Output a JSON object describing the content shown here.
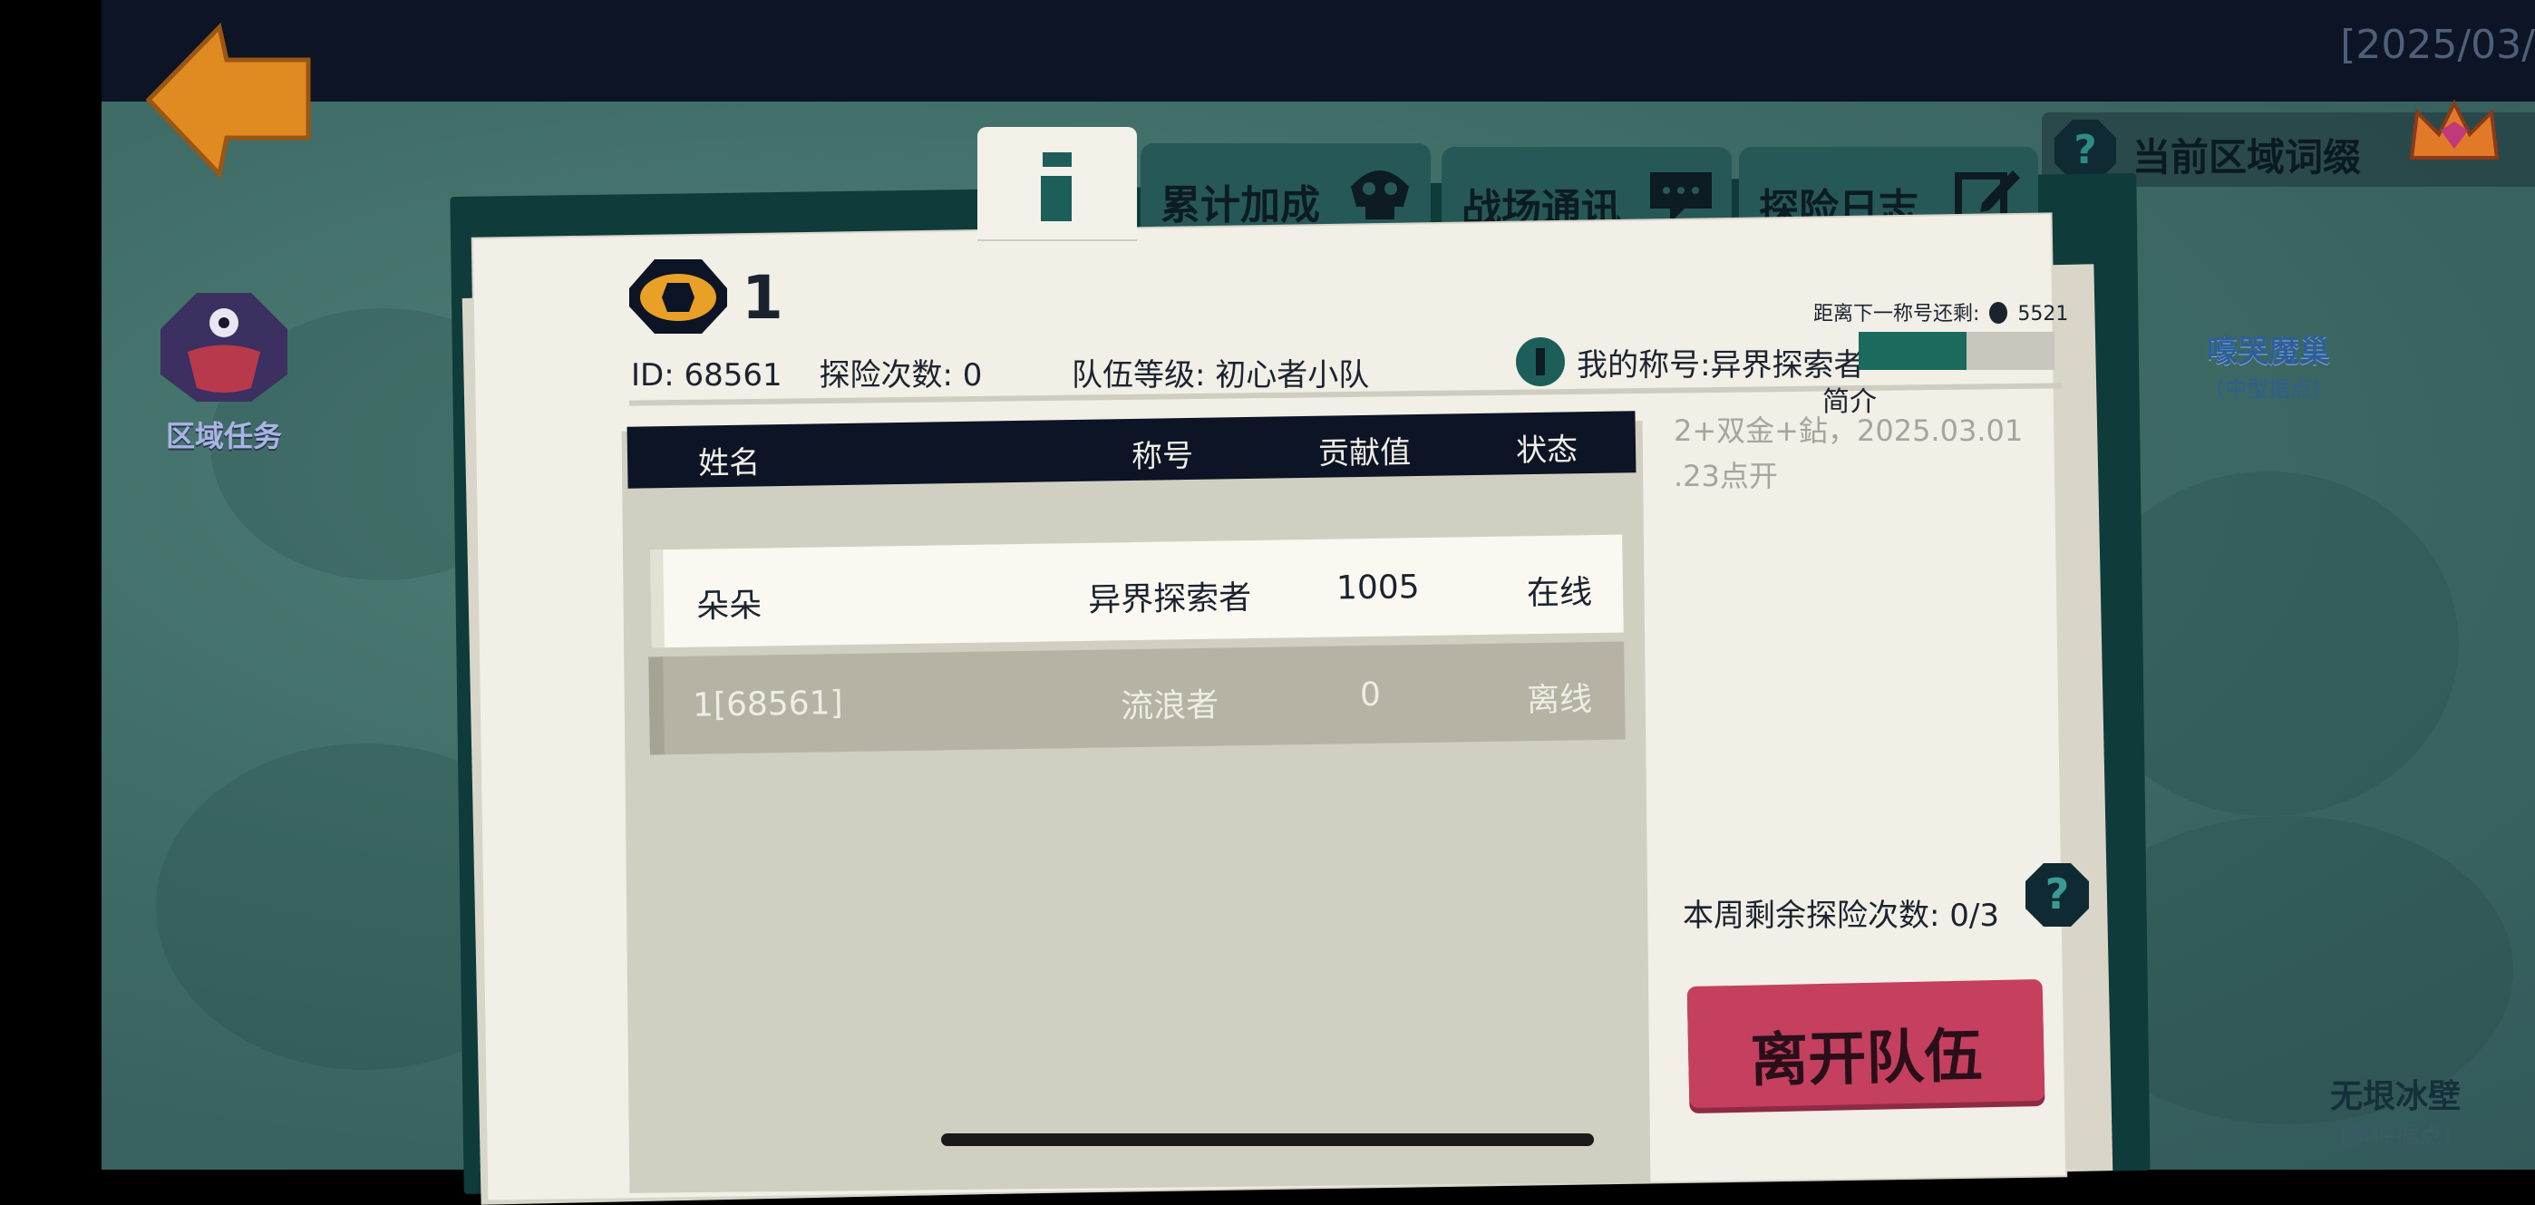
{
  "status": {
    "timestamp": "[2025/03/"
  },
  "nav": {
    "back": "back",
    "zone_task_label": "区域任务"
  },
  "affix": {
    "label": "当前区域词缀"
  },
  "map_labels": [
    {
      "title": "嚎哭魔巢",
      "sub": "(中型据点)"
    },
    {
      "title": "无垠冰壁",
      "sub": "(事件据点)"
    }
  ],
  "tabs": [
    {
      "label": "累计加成",
      "icon": "skull-icon"
    },
    {
      "label": "战场通讯",
      "icon": "chat-icon"
    },
    {
      "label": "探险日志",
      "icon": "edit-icon"
    }
  ],
  "team": {
    "number": "1",
    "id_text": "ID: 68561",
    "explore_count_text": "探险次数: 0",
    "level_text": "队伍等级: 初心者小队",
    "next_title_label": "距离下一称号还剩:",
    "next_title_value": "5521",
    "my_title_text": "我的称号:异界探索者",
    "title_progress": 0.55,
    "intro_label": "简介",
    "intro_text": "2+双金+鉆，2025.03.01 .23点开"
  },
  "table": {
    "headers": [
      "姓名",
      "称号",
      "贡献值",
      "状态"
    ],
    "rows": [
      {
        "name": "朵朵",
        "title": "异界探索者",
        "contribution": "1005",
        "status": "在线"
      },
      {
        "name": "1[68561]",
        "title": "流浪者",
        "contribution": "0",
        "status": "离线"
      }
    ]
  },
  "weekly": {
    "text": "本周剩余探险次数:",
    "value": "0/3"
  },
  "leave_button": "离开队伍",
  "colors": {
    "accent_teal": "#275858",
    "leave_red": "#c4405e",
    "header_navy": "#0c1425",
    "paper": "#f1efe6"
  }
}
